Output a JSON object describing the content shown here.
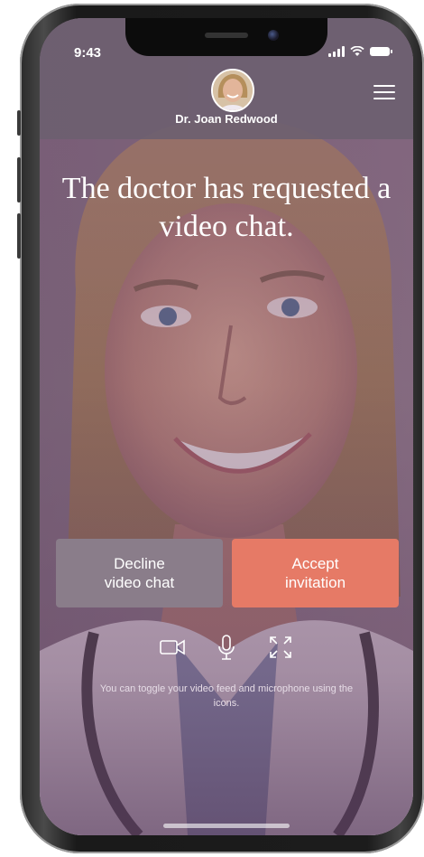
{
  "status_bar": {
    "time": "9:43"
  },
  "header": {
    "doctor_name": "Dr. Joan Redwood",
    "menu_icon": "hamburger-menu-icon",
    "avatar_icon": "doctor-avatar"
  },
  "main": {
    "headline": "The doctor has requested a video chat.",
    "decline_label": "Decline\nvideo chat",
    "accept_label": "Accept\ninvitation",
    "hint": "You can toggle your video feed and microphone using the icons.",
    "icons": [
      "video-camera-icon",
      "microphone-icon",
      "fullscreen-icon"
    ]
  },
  "colors": {
    "accept": "#e67a66",
    "decline": "#8a7d8a",
    "overlay": "#785276",
    "header": "#6c5f70"
  }
}
